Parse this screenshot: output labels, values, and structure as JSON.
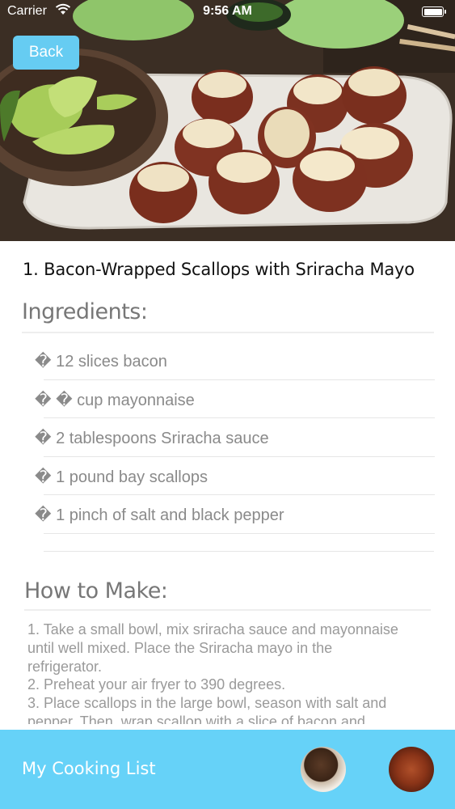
{
  "status_bar": {
    "carrier": "Carrier",
    "time": "9:56 AM"
  },
  "nav": {
    "back_label": "Back"
  },
  "recipe": {
    "title": "1. Bacon-Wrapped Scallops with Sriracha Mayo",
    "ingredients_heading": "Ingredients:",
    "ingredients": [
      "� 12 slices bacon",
      "� � cup mayonnaise",
      "� 2 tablespoons Sriracha sauce",
      "� 1 pound bay scallops",
      "� 1 pinch of salt and black pepper"
    ],
    "howto_heading": "How to Make:",
    "howto_lines": [
      "1. Take a small bowl, mix sriracha sauce and mayonnaise",
      "until well mixed. Place the Sriracha mayo in the",
      "refrigerator.",
      "2. Preheat your air fryer to 390 degrees.",
      "3. Place scallops in the large bowl, season with salt and",
      "pepper. Then, wrap scallop with a slice of bacon and"
    ]
  },
  "bottom_bar": {
    "label": "My Cooking List"
  },
  "colors": {
    "accent": "#66ccf2",
    "bottom_bar": "#66d2f8",
    "muted_text": "#8a8a8a"
  },
  "icons": [
    "wifi-icon",
    "battery-icon"
  ]
}
